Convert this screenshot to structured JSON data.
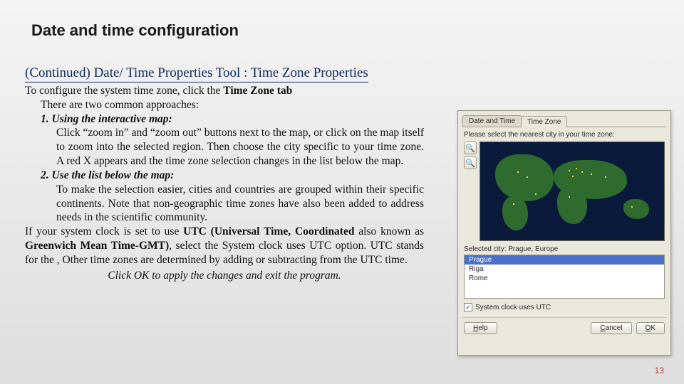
{
  "title": "Date and time configuration",
  "subtitle": "(Continued) Date/ Time Properties Tool : Time Zone Properties",
  "body": {
    "intro_a": "To configure the system time zone, click the ",
    "intro_b": "Time Zone tab",
    "approaches": "There are two common approaches:",
    "m1_head": "1. Using the interactive map:",
    "m1_text": "Click “zoom in” and “zoom out” buttons next to the map, or click on the map itself to zoom into the selected region. Then choose the city specific to your time zone. A red X appears and the time zone selection changes in the list below the map.",
    "m2_head": "2. Use the list below the map:",
    "m2_text": " To make the selection easier, cities and countries are grouped within their specific continents. Note that non-geographic time zones have also been added to address needs in the scientific community.",
    "utc_a": "If your system clock is set to use ",
    "utc_b": "UTC (Universal Time, Coordinated",
    "utc_c": " also known as ",
    "utc_d": "Greenwich Mean Time-GMT)",
    "utc_e": ", select the System clock uses UTC option. UTC stands for the , Other time zones are determined by adding or subtracting from the UTC time.",
    "closing": "Click OK to apply the changes and exit the program."
  },
  "dialog": {
    "tab_datetime": "Date and Time",
    "tab_tz": "Time Zone",
    "hint": "Please select the nearest city in your time zone:",
    "zoom_in": "🔍",
    "zoom_out": "🔍",
    "selected_label": "Selected city: Prague, Europe",
    "cities": [
      "Prague",
      "Riga",
      "Rome"
    ],
    "chk_label": "System clock uses UTC",
    "help_u": "H",
    "help_r": "elp",
    "cancel_u": "C",
    "cancel_r": "ancel",
    "ok_u": "O",
    "ok_r": "K"
  },
  "page_number": "13"
}
